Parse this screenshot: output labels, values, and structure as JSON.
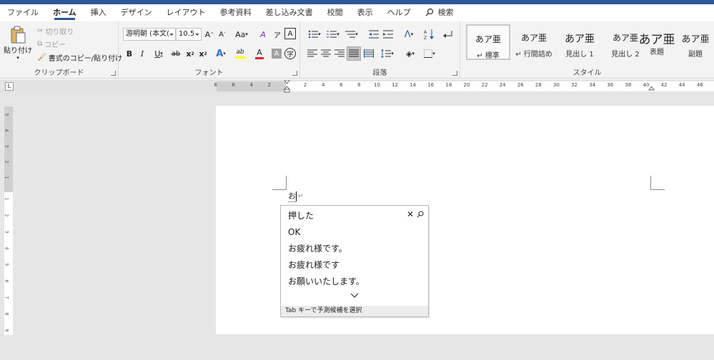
{
  "tabs": [
    {
      "label": "ファイル"
    },
    {
      "label": "ホーム"
    },
    {
      "label": "挿入"
    },
    {
      "label": "デザイン"
    },
    {
      "label": "レイアウト"
    },
    {
      "label": "参考資料"
    },
    {
      "label": "差し込み文書"
    },
    {
      "label": "校閲"
    },
    {
      "label": "表示"
    },
    {
      "label": "ヘルプ"
    }
  ],
  "search": {
    "label": "検索"
  },
  "clipboard": {
    "paste": "貼り付け",
    "cut": "切り取り",
    "copy": "コピー",
    "format_painter": "書式のコピー/貼り付け",
    "group_label": "クリップボード"
  },
  "font": {
    "font_name": "游明朝 (本文(",
    "font_size": "10.5",
    "grow": "A",
    "shrink": "A",
    "change_case": "Aa",
    "clear": "A",
    "phonetic": "ア",
    "border_char": "A",
    "bold": "B",
    "italic": "I",
    "underline": "U",
    "strike": "ab",
    "subscript": "x",
    "superscript": "x",
    "sub_mark": "2",
    "sup_mark": "2",
    "effects": "A",
    "highlight": "ab",
    "color": "A",
    "shade": "A",
    "enclose": "字",
    "group_label": "フォント"
  },
  "paragraph": {
    "group_label": "段落"
  },
  "styles": {
    "items": [
      {
        "preview": "あア亜",
        "name": "↵ 標準"
      },
      {
        "preview": "あア亜",
        "name": "↵ 行間詰め"
      },
      {
        "preview": "あア亜",
        "name": "見出し 1"
      },
      {
        "preview": "あア亜",
        "name": "見出し 2"
      },
      {
        "preview": "あア亜",
        "name": "表題"
      },
      {
        "preview": "あア亜",
        "name": "副題"
      }
    ],
    "group_label": "スタイル"
  },
  "ruler": {
    "h_labels": [
      "8",
      "6",
      "4",
      "2",
      "2",
      "4",
      "6",
      "8",
      "10",
      "12",
      "14",
      "16",
      "18",
      "20",
      "22",
      "24",
      "26",
      "28",
      "30",
      "32",
      "34",
      "36",
      "38",
      "40",
      "42",
      "44",
      "46"
    ],
    "v_labels": [
      "5",
      "4",
      "3",
      "2",
      "1",
      "1",
      "2",
      "3",
      "4",
      "5",
      "6",
      "7",
      "8",
      "9"
    ],
    "tab_selector": "L"
  },
  "document": {
    "typed_text": "お",
    "paragraph_mark": "↵"
  },
  "ime": {
    "candidates": [
      "押した",
      "OK",
      "お疲れ様です。",
      "お疲れ様です",
      "お願いいたします。"
    ],
    "footer": "Tab キーで予測候補を選択"
  },
  "colors": {
    "accent": "#2b579a",
    "ribbon_bg": "#f3f3f3",
    "canvas_bg": "#e6e6e6",
    "highlight_yellow": "#ffff00",
    "font_red": "#e02020",
    "effects_blue": "#2e74d6"
  }
}
